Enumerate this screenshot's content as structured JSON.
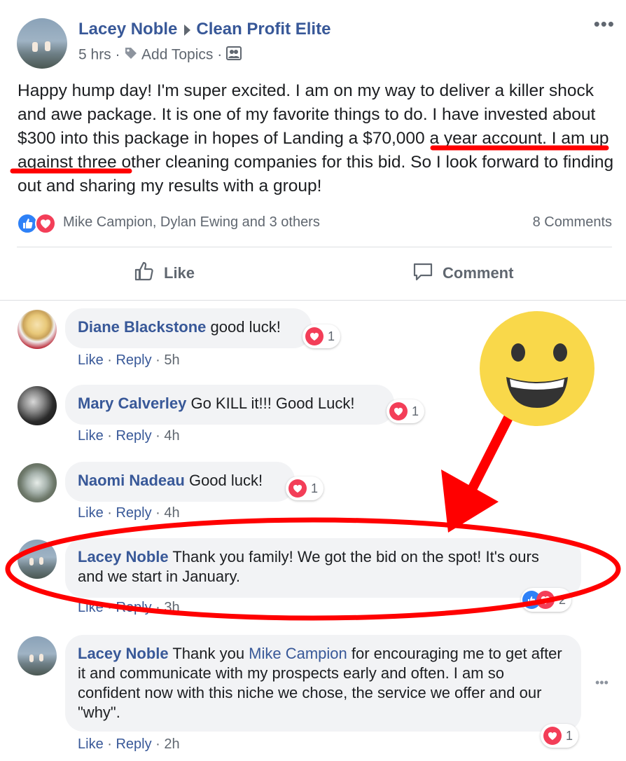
{
  "post": {
    "author": "Lacey Noble",
    "group": "Clean Profit Elite",
    "time": "5 hrs",
    "add_topics": "Add Topics",
    "more": "•••",
    "text": "Happy hump day! I'm super excited. I am on my way to deliver a killer shock and awe package. It is one of my favorite things to do. I have invested about $300 into this package in hopes of Landing a $70,000 a year account. I am up against three other cleaning companies for this bid. So I look forward to finding out and sharing my results with a group!",
    "reactions_text": "Mike Campion, Dylan Ewing and 3 others",
    "comments_count": "8 Comments",
    "like_label": "Like",
    "comment_label": "Comment"
  },
  "comments": [
    {
      "author": "Diane Blackstone",
      "text": "good luck!",
      "like": "Like",
      "reply": "Reply",
      "time": "5h",
      "reaction_count": "1"
    },
    {
      "author": "Mary Calverley",
      "text": "Go KILL it!!! Good Luck!",
      "like": "Like",
      "reply": "Reply",
      "time": "4h",
      "reaction_count": "1"
    },
    {
      "author": "Naomi Nadeau",
      "text": "Good luck!",
      "like": "Like",
      "reply": "Reply",
      "time": "4h",
      "reaction_count": "1"
    },
    {
      "author": "Lacey Noble",
      "text": "Thank you family! We got the bid on the spot! It's ours and we start in January.",
      "like": "Like",
      "reply": "Reply",
      "time": "3h",
      "reaction_count": "2"
    },
    {
      "author": "Lacey Noble",
      "text_before": "Thank you ",
      "mention": "Mike Campion",
      "text_after": " for encouraging me to get after it and communicate with my prospects early and often. I am so confident now with this niche we chose, the service we offer and our \"why\".",
      "like": "Like",
      "reply": "Reply",
      "time": "2h",
      "reaction_count": "1",
      "more": "•••"
    }
  ],
  "colors": {
    "link": "#385898",
    "muted": "#606770",
    "bubble": "#f2f3f5",
    "like_blue": "#2e81f7",
    "love_red": "#f33e58",
    "annotation_red": "#ff0000",
    "emoji_yellow": "#f9d84a"
  },
  "icons": [
    "tag-icon",
    "group-members-icon",
    "thumbs-up-icon",
    "comment-bubble-icon",
    "heart-icon",
    "like-icon",
    "grinning-emoji-icon"
  ]
}
